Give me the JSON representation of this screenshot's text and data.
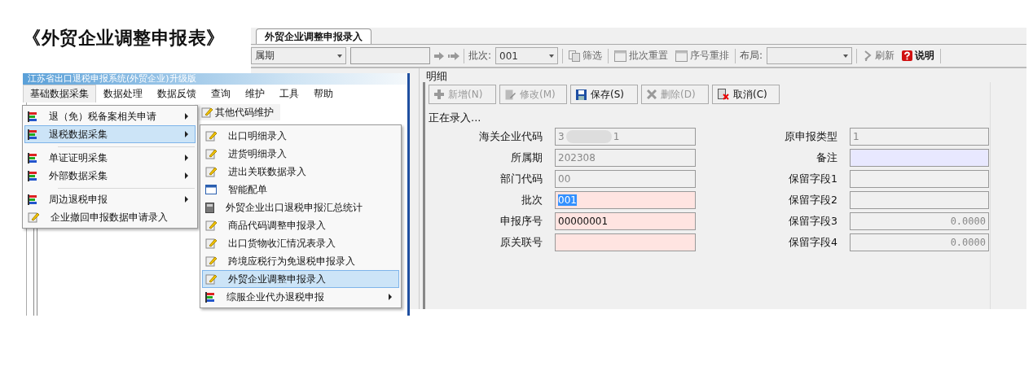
{
  "title": "《外贸企业调整申报表》",
  "app_window": {
    "tabs": [
      {
        "label": "外贸企业调整申报录入",
        "selected": true
      }
    ],
    "toolbar": {
      "period_dropdown": "属期",
      "batch_label": "批次:",
      "batch_dropdown": "001",
      "filter_button": "筛选",
      "reset_batch_button": "批次重置",
      "renumber_button": "序号重排",
      "layout_label": "布局:",
      "refresh_button": "刷新",
      "help_button": "说明"
    },
    "detail": {
      "group_label": "明细",
      "buttons": [
        {
          "label": "新增(N)",
          "kind": "add",
          "disabled": true
        },
        {
          "label": "修改(M)",
          "kind": "edit",
          "disabled": true
        },
        {
          "label": "保存(S)",
          "kind": "save",
          "disabled": false
        },
        {
          "label": "删除(D)",
          "kind": "delete",
          "disabled": true
        },
        {
          "label": "取消(C)",
          "kind": "cancel",
          "disabled": false
        }
      ],
      "status": "正在录入...",
      "fields": [
        {
          "label": "海关企业代码",
          "kind": "readonly",
          "value_parts": [
            "3",
            "1"
          ],
          "redacted": true
        },
        {
          "label": "原申报类型",
          "kind": "readonly",
          "value": "1"
        },
        {
          "label": "所属期",
          "kind": "readonly",
          "value": "202308"
        },
        {
          "label": "备注",
          "kind": "note"
        },
        {
          "label": "部门代码",
          "kind": "readonly",
          "value": "00"
        },
        {
          "label": "保留字段1",
          "kind": "plain"
        },
        {
          "label": "批次",
          "kind": "required",
          "value": "001",
          "value_selected": true
        },
        {
          "label": "保留字段2",
          "kind": "plain"
        },
        {
          "label": "申报序号",
          "kind": "required",
          "value": "00000001",
          "value_selected": false
        },
        {
          "label": "保留字段3",
          "kind": "number",
          "value": "0.0000"
        },
        {
          "label": "原关联号",
          "kind": "required"
        },
        {
          "label": "保留字段4",
          "kind": "number",
          "value": "0.0000"
        }
      ]
    }
  },
  "menu_window": {
    "title": "江苏省出口退税申报系统(外贸企业)升级版",
    "menubar": [
      {
        "label": "基础数据采集",
        "selected": true
      },
      {
        "label": "数据处理",
        "selected": false
      },
      {
        "label": "数据反馈",
        "selected": false
      },
      {
        "label": "查询",
        "selected": false
      },
      {
        "label": "维护",
        "selected": false
      },
      {
        "label": "工具",
        "selected": false
      },
      {
        "label": "帮助",
        "selected": false
      }
    ],
    "toolbar_button": "其他代码维护",
    "menu": [
      {
        "label": "退（免）税备案相关申请",
        "kind": "group",
        "has_submenu": true,
        "selected": false,
        "separator_before": false
      },
      {
        "label": "退税数据采集",
        "kind": "group",
        "has_submenu": true,
        "selected": true,
        "separator_before": false
      },
      {
        "label": "单证证明采集",
        "kind": "group",
        "has_submenu": true,
        "selected": false,
        "separator_before": true
      },
      {
        "label": "外部数据采集",
        "kind": "group",
        "has_submenu": true,
        "selected": false,
        "separator_before": false
      },
      {
        "label": "周边退税申报",
        "kind": "group",
        "has_submenu": true,
        "selected": false,
        "separator_before": true
      },
      {
        "label": "企业撤回申报数据申请录入",
        "kind": "entry",
        "has_submenu": false,
        "selected": false,
        "separator_before": false
      }
    ],
    "submenu": [
      {
        "label": "出口明细录入",
        "kind": "entry",
        "has_submenu": false,
        "selected": false
      },
      {
        "label": "进货明细录入",
        "kind": "entry",
        "has_submenu": false,
        "selected": false
      },
      {
        "label": "进出关联数据录入",
        "kind": "entry",
        "has_submenu": false,
        "selected": false
      },
      {
        "label": "智能配单",
        "kind": "window",
        "has_submenu": false,
        "selected": false
      },
      {
        "label": "外贸企业出口退税申报汇总统计",
        "kind": "report",
        "has_submenu": false,
        "selected": false
      },
      {
        "label": "商品代码调整申报录入",
        "kind": "entry",
        "has_submenu": false,
        "selected": false
      },
      {
        "label": "出口货物收汇情况表录入",
        "kind": "entry",
        "has_submenu": false,
        "selected": false
      },
      {
        "label": "跨境应税行为免退税申报录入",
        "kind": "entry",
        "has_submenu": false,
        "selected": false
      },
      {
        "label": "外贸企业调整申报录入",
        "kind": "entry",
        "has_submenu": false,
        "selected": true
      },
      {
        "label": "综服企业代办退税申报",
        "kind": "group",
        "has_submenu": true,
        "selected": false
      }
    ]
  }
}
